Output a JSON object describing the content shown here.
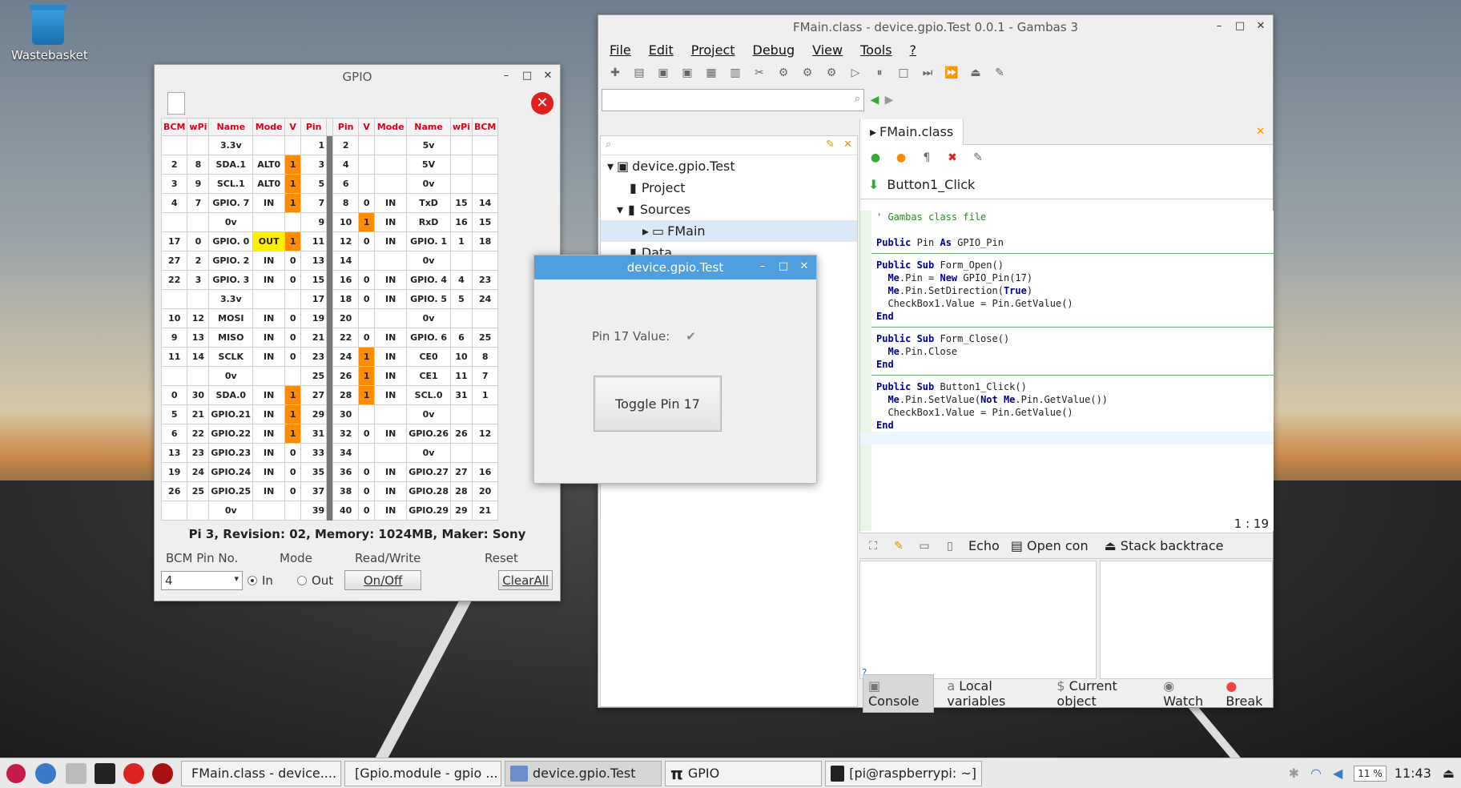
{
  "desktop": {
    "wastebasket": "Wastebasket"
  },
  "gpio": {
    "title": "GPIO",
    "headers": [
      "BCM",
      "wPi",
      "Name",
      "Mode",
      "V",
      "Pin",
      "Pin",
      "V",
      "Mode",
      "Name",
      "wPi",
      "BCM"
    ],
    "rows": [
      [
        "",
        "",
        "3.3v",
        "",
        "",
        "1",
        "2",
        "",
        "",
        "5v",
        "",
        ""
      ],
      [
        "2",
        "8",
        "SDA.1",
        "ALT0",
        "1",
        "3",
        "4",
        "",
        "",
        "5V",
        "",
        ""
      ],
      [
        "3",
        "9",
        "SCL.1",
        "ALT0",
        "1",
        "5",
        "6",
        "",
        "",
        "0v",
        "",
        ""
      ],
      [
        "4",
        "7",
        "GPIO. 7",
        "IN",
        "1",
        "7",
        "8",
        "0",
        "IN",
        "TxD",
        "15",
        "14"
      ],
      [
        "",
        "",
        "0v",
        "",
        "",
        "9",
        "10",
        "1",
        "IN",
        "RxD",
        "16",
        "15"
      ],
      [
        "17",
        "0",
        "GPIO. 0",
        "OUT",
        "1",
        "11",
        "12",
        "0",
        "IN",
        "GPIO. 1",
        "1",
        "18"
      ],
      [
        "27",
        "2",
        "GPIO. 2",
        "IN",
        "0",
        "13",
        "14",
        "",
        "",
        "0v",
        "",
        ""
      ],
      [
        "22",
        "3",
        "GPIO. 3",
        "IN",
        "0",
        "15",
        "16",
        "0",
        "IN",
        "GPIO. 4",
        "4",
        "23"
      ],
      [
        "",
        "",
        "3.3v",
        "",
        "",
        "17",
        "18",
        "0",
        "IN",
        "GPIO. 5",
        "5",
        "24"
      ],
      [
        "10",
        "12",
        "MOSI",
        "IN",
        "0",
        "19",
        "20",
        "",
        "",
        "0v",
        "",
        ""
      ],
      [
        "9",
        "13",
        "MISO",
        "IN",
        "0",
        "21",
        "22",
        "0",
        "IN",
        "GPIO. 6",
        "6",
        "25"
      ],
      [
        "11",
        "14",
        "SCLK",
        "IN",
        "0",
        "23",
        "24",
        "1",
        "IN",
        "CE0",
        "10",
        "8"
      ],
      [
        "",
        "",
        "0v",
        "",
        "",
        "25",
        "26",
        "1",
        "IN",
        "CE1",
        "11",
        "7"
      ],
      [
        "0",
        "30",
        "SDA.0",
        "IN",
        "1",
        "27",
        "28",
        "1",
        "IN",
        "SCL.0",
        "31",
        "1"
      ],
      [
        "5",
        "21",
        "GPIO.21",
        "IN",
        "1",
        "29",
        "30",
        "",
        "",
        "0v",
        "",
        ""
      ],
      [
        "6",
        "22",
        "GPIO.22",
        "IN",
        "1",
        "31",
        "32",
        "0",
        "IN",
        "GPIO.26",
        "26",
        "12"
      ],
      [
        "13",
        "23",
        "GPIO.23",
        "IN",
        "0",
        "33",
        "34",
        "",
        "",
        "0v",
        "",
        ""
      ],
      [
        "19",
        "24",
        "GPIO.24",
        "IN",
        "0",
        "35",
        "36",
        "0",
        "IN",
        "GPIO.27",
        "27",
        "16"
      ],
      [
        "26",
        "25",
        "GPIO.25",
        "IN",
        "0",
        "37",
        "38",
        "0",
        "IN",
        "GPIO.28",
        "28",
        "20"
      ],
      [
        "",
        "",
        "0v",
        "",
        "",
        "39",
        "40",
        "0",
        "IN",
        "GPIO.29",
        "29",
        "21"
      ]
    ],
    "info": "Pi 3, Revision: 02, Memory: 1024MB, Maker: Sony",
    "labels": {
      "bcm": "BCM Pin No.",
      "mode": "Mode",
      "rw": "Read/Write",
      "reset": "Reset"
    },
    "pin_value": "4",
    "radio_in": "In",
    "radio_out": "Out",
    "onoff": "On/Off",
    "clearall": "ClearAll",
    "colors": {
      "high": "#ff8c00",
      "out": "#ffef00",
      "header": "#e0001a"
    }
  },
  "ide": {
    "title": "FMain.class - device.gpio.Test 0.0.1 - Gambas 3",
    "menu": [
      "File",
      "Edit",
      "Project",
      "Debug",
      "View",
      "Tools",
      "?"
    ],
    "tree": [
      "device.gpio.Test",
      "Project",
      "Sources",
      "FMain",
      "Data"
    ],
    "tab": "FMain.class",
    "proc": "Button1_Click",
    "cursor": "1 : 19",
    "bottom_tools": [
      "Echo",
      "Open con",
      "Stack backtrace"
    ],
    "bottom_tabs": [
      "Console",
      "Local variables",
      "Current object",
      "Watch",
      "Break"
    ],
    "prompt": "?"
  },
  "dialog": {
    "title": "device.gpio.Test",
    "label": "Pin 17 Value:",
    "button": "Toggle Pin 17"
  },
  "taskbar": {
    "items": [
      "FMain.class - device....",
      "[Gpio.module - gpio ...",
      "device.gpio.Test",
      "GPIO",
      "[pi@raspberrypi: ~]"
    ],
    "cpu": "11 %",
    "time": "11:43"
  }
}
